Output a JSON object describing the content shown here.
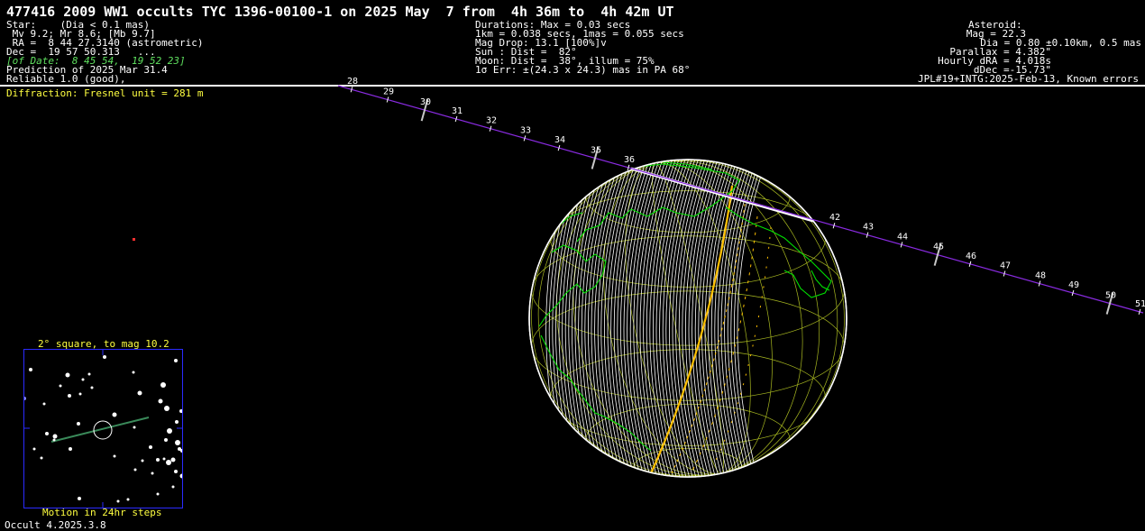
{
  "title": "477416 2009 WW1 occults TYC 1396-00100-1 on 2025 May  7 from  4h 36m to  4h 42m UT",
  "star_block": [
    "Star:    (Dia < 0.1 mas)",
    " Mv 9.2; Mr 8.6; [Mb 9.7]",
    " RA =  8 44 27.3140 (astrometric)",
    "Dec =  19 57 50.313   ...",
    "[of Date:  8 45 54,  19 52 23]",
    "Prediction of 2025 Mar 31.4",
    "Reliable 1.0 (good),"
  ],
  "middle_block": [
    "Durations: Max = 0.03 secs",
    "1km = 0.038 secs, 1mas = 0.055 secs",
    "Mag Drop: 13.1 [100%]v",
    "Sun : Dist =  82°",
    "Moon: Dist =  38°, illum = 75%",
    "1σ Err: ±(24.3 x 24.3) mas in PA 68°"
  ],
  "asteroid_block": [
    "Asteroid:",
    "Mag = 22.3",
    "Dia = 0.80 ±0.10km, 0.5 mas",
    "Parallax = 4.382\"",
    "Hourly dRA = 4.018s",
    "dDec =-15.73\"",
    "JPL#19+INTG:2025-Feb-13, Known errors"
  ],
  "diffraction": "Diffraction: Fresnel unit = 281 m",
  "path_minutes": [
    "28",
    "29",
    "30",
    "31",
    "32",
    "33",
    "34",
    "35",
    "36",
    "42",
    "43",
    "44",
    "45",
    "46",
    "47",
    "48",
    "49",
    "50",
    "51"
  ],
  "inset": {
    "title": "2° square, to mag 10.2",
    "caption": "Motion in 24hr steps"
  },
  "version": "Occult 4.2025.3.8",
  "colors": {
    "background": "#000000",
    "coastline": "#00e000",
    "grid": "#a8b820",
    "terminator": "#ffc000",
    "path": "#8a2be2",
    "info_green": "#5fe05f",
    "info_yellow": "#ffff40",
    "inset_border": "#2a2aff"
  }
}
